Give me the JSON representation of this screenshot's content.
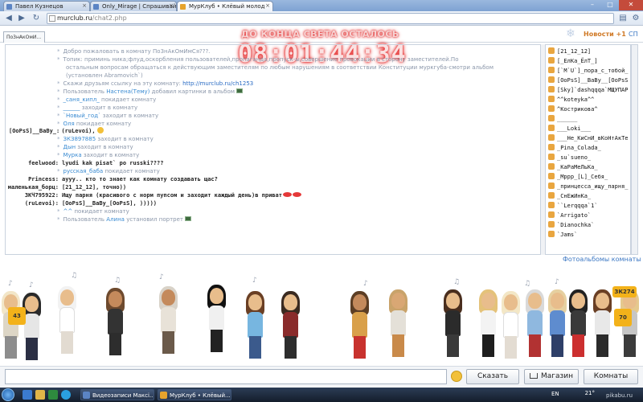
{
  "browser": {
    "tabs": [
      {
        "label": "Павел Кузнецов"
      },
      {
        "label": "Only_Mirage | Спрашивай"
      },
      {
        "label": "МурКлуб • Клёвый молод"
      }
    ],
    "url_domain": "murclub.ru",
    "url_path": "/chat2.php"
  },
  "header": {
    "room_tab": "По3нАкОмИ...",
    "countdown_label": "ДО КОНЦА СВЕТА ОСТАЛОСЬ",
    "countdown_time": "08:01:44:34",
    "news": "Новости +1",
    "sp": "СП"
  },
  "chat": {
    "lines": [
      {
        "type": "sys",
        "text": "Добро пожаловать в комнату По3нАкОмИмСя???."
      },
      {
        "type": "sys",
        "text": "Топик: приминь ника;флуд,оскорбления пользователей,пропаганда,пропуск-ы,совершение провокации в сторону заместителей.По"
      },
      {
        "type": "sys2",
        "text": "остальным вопросам обращаться к действующим заместителям по любым нарушениям в соответствии Конституции муркгуба-смотри альбом"
      },
      {
        "type": "sys2",
        "text": "(установлен Abramovich`)"
      },
      {
        "type": "sys",
        "text": "Скажи друзьям ссылку на эту комнату: ",
        "link": "http://murclub.ru/ch1253"
      },
      {
        "type": "sys",
        "text": "Пользователь ",
        "nick": "Настена(Тему)",
        "rest": " добавил картинки в альбом"
      },
      {
        "type": "sys",
        "nick": "_саня_кипл_",
        "rest": " покидает комнату"
      },
      {
        "type": "sys",
        "nick": "______",
        "rest": " заходит в комнату"
      },
      {
        "type": "sys",
        "nick": "`Новый_год`",
        "rest": " заходит в комнату"
      },
      {
        "type": "sys",
        "nick": "Оля",
        "rest": " покидает комнату"
      },
      {
        "type": "msg",
        "who": "[OoPsS]__BaBy_:",
        "text": "(ruLevoi),"
      },
      {
        "type": "sys",
        "nick": "ЗКЗ897885",
        "rest": " заходит в комнату"
      },
      {
        "type": "sys",
        "nick": "Дын",
        "rest": " заходит в комнату"
      },
      {
        "type": "sys",
        "nick": "Мурка",
        "rest": " заходит в комнату"
      },
      {
        "type": "msg",
        "who": "feelwood:",
        "text": "lyudi kak pisat` po russki????"
      },
      {
        "type": "sys",
        "nick": "русская_баба",
        "rest": " покидает комнату"
      },
      {
        "type": "msg",
        "who": "Princess:",
        "text": "ayyy.. кто то знает как комнату создавать щас?"
      },
      {
        "type": "msg",
        "who": "маленькая_борц:",
        "text": "[21_12_12], точно))"
      },
      {
        "type": "msg",
        "who": "ЗКЧ795922:",
        "text": "Ищу парня (красивого с норм пупсом и  заходит каждый день)в приват"
      },
      {
        "type": "msg",
        "who": "(ruLevoi):",
        "text": "[OoPsS]__BaBy_[OoPsS], )))))"
      },
      {
        "type": "sys",
        "nick": "^^",
        "rest": " покидает комнату"
      },
      {
        "type": "sys",
        "text": "Пользователь ",
        "nick": "Алина",
        "rest": " установил портрет"
      }
    ]
  },
  "users": [
    "[21_12_12]",
    "[_ЕлКа_ЁлТ_]",
    "[`M`U`]_пора_с_тобой_",
    "[OoPsS]__BaBy__[OoPsS",
    "[Sky]`dashqqqa`МЩУПАР",
    "^^koteyka^^",
    "^Кострикова^",
    "______",
    "___Loki___",
    "___Не_КиСнИ_вКоНтАкТе",
    "_Pina_Colada_",
    "_su`sueno_",
    "_КаРаМеЛьКа_",
    "_Мррр_[L]_Себя_",
    "_принцесса_ищу_парня_",
    "_СнЕжИнКа_",
    "``Lerqqqa`1`",
    "`Arrigato`",
    "`Dianochka`",
    "`Jams`"
  ],
  "photoalbums": "Фотоальбомы комнаты",
  "avatar_badges": [
    "43",
    "70",
    "ЗК274"
  ],
  "bottom": {
    "input_placeholder": "",
    "say": "Сказать",
    "shop": "Магазин",
    "rooms": "Комнаты"
  },
  "taskbar": {
    "items": [
      {
        "label": "Видеозаписи Максі..."
      },
      {
        "label": "МурКлуб • Клёвый..."
      }
    ],
    "lang": "EN",
    "clock": "21°",
    "watermark": "pikabu.ru"
  },
  "colors": {
    "accent": "#3c78c4",
    "countdown": "#e31b1b",
    "news": "#d07a27"
  }
}
